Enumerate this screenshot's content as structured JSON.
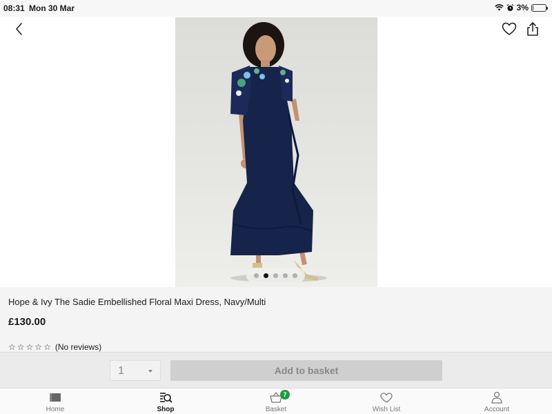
{
  "status_bar": {
    "time": "08:31",
    "date": "Mon 30 Mar",
    "battery": "3%",
    "battery_level": 0.03
  },
  "nav": {
    "back_icon": "chevron-left-icon",
    "wishlist_icon": "heart-icon",
    "share_icon": "share-icon"
  },
  "gallery": {
    "image_count": 5,
    "active_index": 1
  },
  "product": {
    "title": "Hope & Ivy The Sadie Embellished Floral Maxi Dress, Navy/Multi",
    "price": "£130.00",
    "reviews": "(No reviews)",
    "rating_stars": 0
  },
  "purchase": {
    "quantity": "1",
    "add_label": "Add to basket"
  },
  "tabs": [
    {
      "label": "Home",
      "icon": "home-icon",
      "active": false
    },
    {
      "label": "Shop",
      "icon": "shop-search-icon",
      "active": true
    },
    {
      "label": "Basket",
      "icon": "basket-icon",
      "active": false,
      "badge": "7"
    },
    {
      "label": "Wish List",
      "icon": "heart-icon",
      "active": false
    },
    {
      "label": "Account",
      "icon": "person-icon",
      "active": false
    }
  ],
  "colors": {
    "dress": "#16234a",
    "badge": "#1f9a3c",
    "button_disabled": "#cfcfcf"
  }
}
